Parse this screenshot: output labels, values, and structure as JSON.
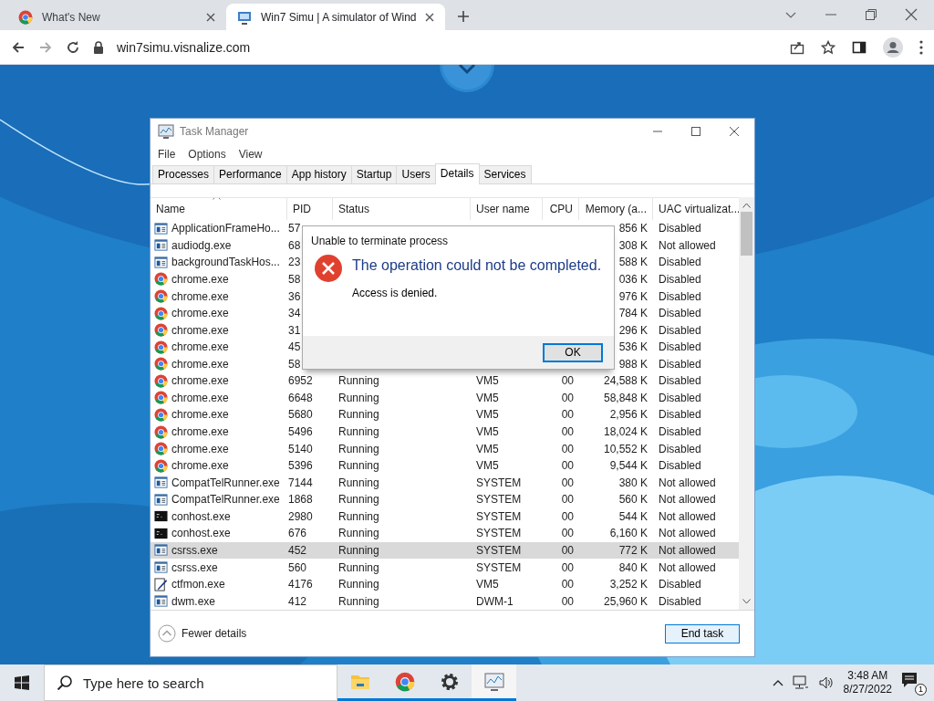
{
  "browser": {
    "tabs": [
      {
        "title": "What's New",
        "selected": false
      },
      {
        "title": "Win7 Simu | A simulator of Wind",
        "selected": true
      }
    ],
    "address": "win7simu.visnalize.com"
  },
  "window": {
    "title": "Task Manager",
    "menu": [
      "File",
      "Options",
      "View"
    ],
    "tabs": [
      {
        "label": "Processes",
        "selected": false
      },
      {
        "label": "Performance",
        "selected": false
      },
      {
        "label": "App history",
        "selected": false
      },
      {
        "label": "Startup",
        "selected": false
      },
      {
        "label": "Users",
        "selected": false
      },
      {
        "label": "Details",
        "selected": true
      },
      {
        "label": "Services",
        "selected": false
      }
    ],
    "columns": [
      "Name",
      "PID",
      "Status",
      "User name",
      "CPU",
      "Memory (a...",
      "UAC virtualizat..."
    ],
    "rows": [
      {
        "kind": "app",
        "name": "ApplicationFrameHo...",
        "pid": "57",
        "memory": "856 K",
        "uac": "Disabled",
        "selected": false
      },
      {
        "kind": "app",
        "name": "audiodg.exe",
        "pid": "68",
        "memory": "308 K",
        "uac": "Not allowed",
        "selected": false
      },
      {
        "kind": "app",
        "name": "backgroundTaskHos...",
        "pid": "23",
        "memory": "588 K",
        "uac": "Disabled",
        "selected": false
      },
      {
        "kind": "chrome",
        "name": "chrome.exe",
        "pid": "58",
        "memory": "036 K",
        "uac": "Disabled",
        "selected": false
      },
      {
        "kind": "chrome",
        "name": "chrome.exe",
        "pid": "36",
        "memory": "976 K",
        "uac": "Disabled",
        "selected": false
      },
      {
        "kind": "chrome",
        "name": "chrome.exe",
        "pid": "34",
        "memory": "784 K",
        "uac": "Disabled",
        "selected": false
      },
      {
        "kind": "chrome",
        "name": "chrome.exe",
        "pid": "31",
        "memory": "296 K",
        "uac": "Disabled",
        "selected": false
      },
      {
        "kind": "chrome",
        "name": "chrome.exe",
        "pid": "45",
        "memory": "536 K",
        "uac": "Disabled",
        "selected": false
      },
      {
        "kind": "chrome",
        "name": "chrome.exe",
        "pid": "58",
        "memory": "988 K",
        "uac": "Disabled",
        "selected": false
      },
      {
        "kind": "chrome",
        "name": "chrome.exe",
        "pid": "6952",
        "status": "Running",
        "user": "VM5",
        "cpu": "00",
        "memory": "24,588 K",
        "uac": "Disabled",
        "selected": false
      },
      {
        "kind": "chrome",
        "name": "chrome.exe",
        "pid": "6648",
        "status": "Running",
        "user": "VM5",
        "cpu": "00",
        "memory": "58,848 K",
        "uac": "Disabled",
        "selected": false
      },
      {
        "kind": "chrome",
        "name": "chrome.exe",
        "pid": "5680",
        "status": "Running",
        "user": "VM5",
        "cpu": "00",
        "memory": "2,956 K",
        "uac": "Disabled",
        "selected": false
      },
      {
        "kind": "chrome",
        "name": "chrome.exe",
        "pid": "5496",
        "status": "Running",
        "user": "VM5",
        "cpu": "00",
        "memory": "18,024 K",
        "uac": "Disabled",
        "selected": false
      },
      {
        "kind": "chrome",
        "name": "chrome.exe",
        "pid": "5140",
        "status": "Running",
        "user": "VM5",
        "cpu": "00",
        "memory": "10,552 K",
        "uac": "Disabled",
        "selected": false
      },
      {
        "kind": "chrome",
        "name": "chrome.exe",
        "pid": "5396",
        "status": "Running",
        "user": "VM5",
        "cpu": "00",
        "memory": "9,544 K",
        "uac": "Disabled",
        "selected": false
      },
      {
        "kind": "app",
        "name": "CompatTelRunner.exe",
        "pid": "7144",
        "status": "Running",
        "user": "SYSTEM",
        "cpu": "00",
        "memory": "380 K",
        "uac": "Not allowed",
        "selected": false
      },
      {
        "kind": "app",
        "name": "CompatTelRunner.exe",
        "pid": "1868",
        "status": "Running",
        "user": "SYSTEM",
        "cpu": "00",
        "memory": "560 K",
        "uac": "Not allowed",
        "selected": false
      },
      {
        "kind": "console",
        "name": "conhost.exe",
        "pid": "2980",
        "status": "Running",
        "user": "SYSTEM",
        "cpu": "00",
        "memory": "544 K",
        "uac": "Not allowed",
        "selected": false
      },
      {
        "kind": "console",
        "name": "conhost.exe",
        "pid": "676",
        "status": "Running",
        "user": "SYSTEM",
        "cpu": "00",
        "memory": "6,160 K",
        "uac": "Not allowed",
        "selected": false
      },
      {
        "kind": "app",
        "name": "csrss.exe",
        "pid": "452",
        "status": "Running",
        "user": "SYSTEM",
        "cpu": "00",
        "memory": "772 K",
        "uac": "Not allowed",
        "selected": true
      },
      {
        "kind": "app",
        "name": "csrss.exe",
        "pid": "560",
        "status": "Running",
        "user": "SYSTEM",
        "cpu": "00",
        "memory": "840 K",
        "uac": "Not allowed",
        "selected": false
      },
      {
        "kind": "edit",
        "name": "ctfmon.exe",
        "pid": "4176",
        "status": "Running",
        "user": "VM5",
        "cpu": "00",
        "memory": "3,252 K",
        "uac": "Disabled",
        "selected": false
      },
      {
        "kind": "app",
        "name": "dwm.exe",
        "pid": "412",
        "status": "Running",
        "user": "DWM-1",
        "cpu": "00",
        "memory": "25,960 K",
        "uac": "Disabled",
        "selected": false
      }
    ],
    "fewer_details": "Fewer details",
    "end_task": "End task"
  },
  "dialog": {
    "title": "Unable to terminate process",
    "heading": "The operation could not be completed.",
    "message": "Access is denied.",
    "button": "OK"
  },
  "taskbar": {
    "search_placeholder": "Type here to search",
    "pinned": [
      {
        "kind": "folder",
        "active": false
      },
      {
        "kind": "chrome",
        "active": false
      },
      {
        "kind": "gear",
        "active": false
      },
      {
        "kind": "taskmgr",
        "active": true
      }
    ],
    "time": "3:48 AM",
    "date": "8/27/2022",
    "notifications": "1"
  }
}
